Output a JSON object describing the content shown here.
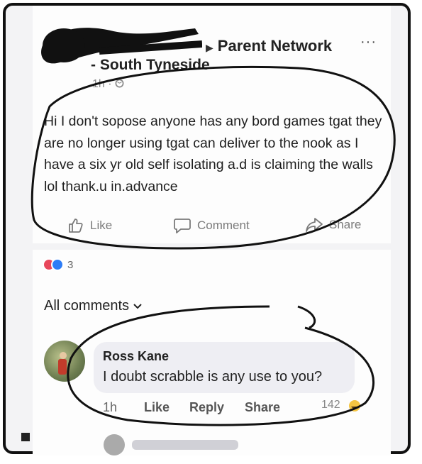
{
  "post": {
    "breadcrumb_arrow": "▶",
    "group_name": "Parent Network",
    "group_location": "- South Tyneside",
    "more_icon": "···",
    "timestamp": "1h ·",
    "body": "Hi I don't sopose anyone has any bord games tgat they are no longer using tgat can deliver to the nook as I have a six yr old self isolating a.d is claiming the walls lol  thank.u in.advance",
    "actions": {
      "like": "Like",
      "comment": "Comment",
      "share": "Share"
    }
  },
  "reactions": {
    "count": "3"
  },
  "comments_filter": "All comments",
  "comment": {
    "author": "Ross Kane",
    "text": "I doubt scrabble is any use to you?",
    "time": "1h",
    "like": "Like",
    "reply": "Reply",
    "share": "Share",
    "reaction_count": "142"
  },
  "colors": {
    "annotation_ink": "#111111",
    "bubble": "#eeeef3",
    "love": "#e8475b",
    "like": "#2d7cf6"
  }
}
